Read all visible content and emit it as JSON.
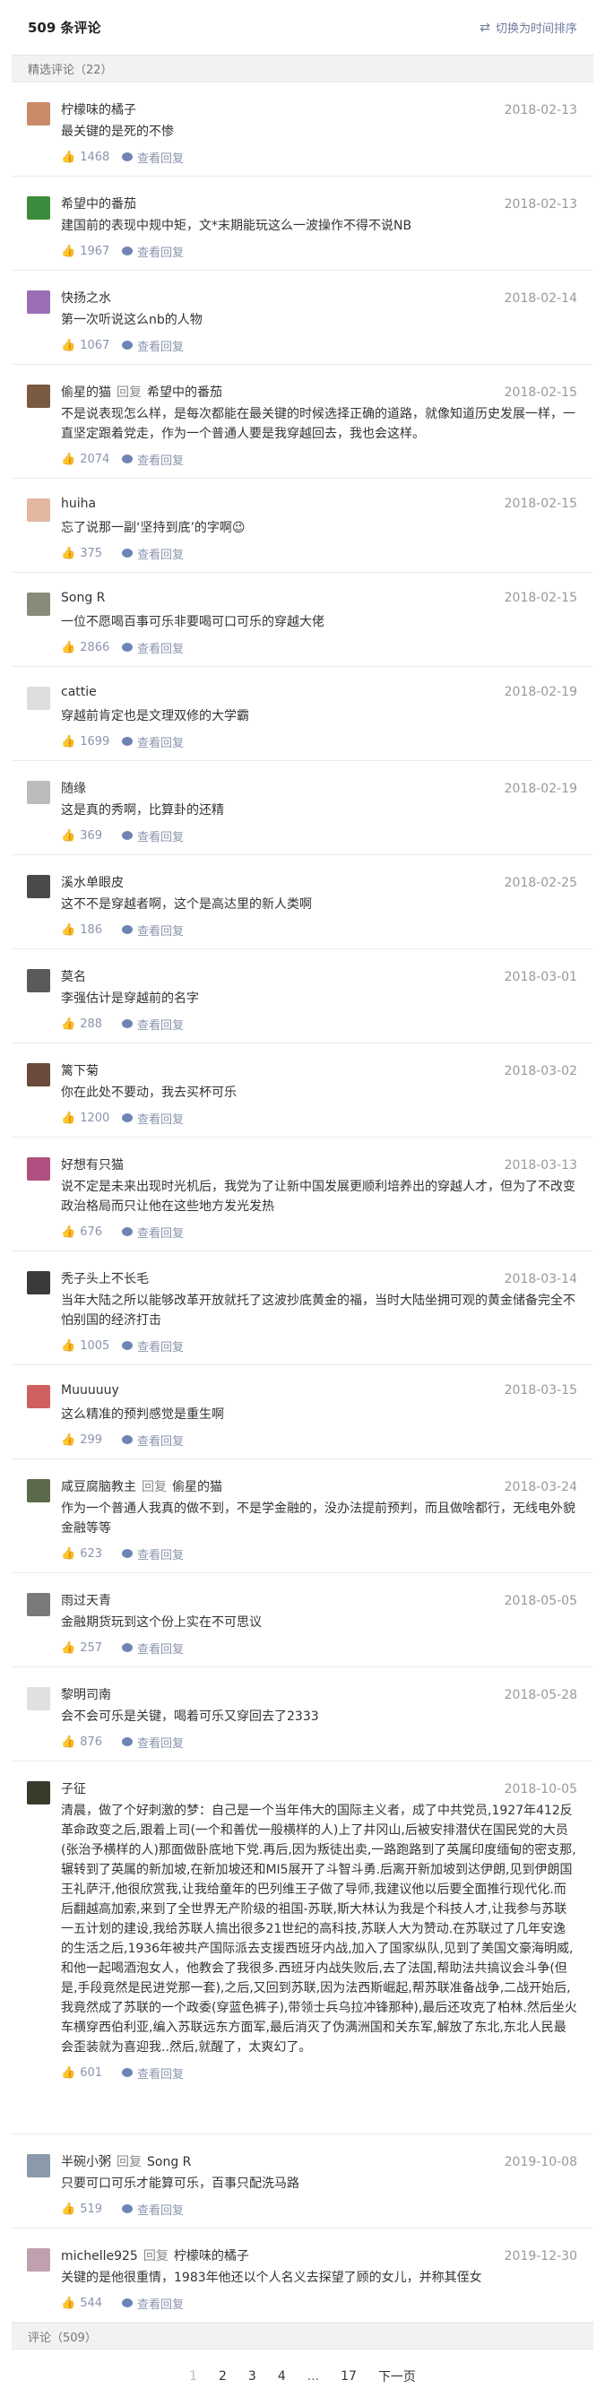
{
  "header": {
    "title": "509 条评论",
    "sort_label": "切换为时间排序"
  },
  "featured": {
    "label": "精选评论（22）"
  },
  "ui": {
    "reply_keyword": "回复",
    "view_reply_label": "查看回复"
  },
  "comments": [
    {
      "user": "柠檬味的橘子",
      "reply_to": "",
      "date": "2018-02-13",
      "text": "最关键的是死的不惨",
      "likes": "1468",
      "avatar_color": "#c98a6a"
    },
    {
      "user": "希望中的番茄",
      "reply_to": "",
      "date": "2018-02-13",
      "text": "建国前的表现中规中矩，文*末期能玩这么一波操作不得不说NB",
      "likes": "1967",
      "avatar_color": "#3d8b3d"
    },
    {
      "user": "快扬之水",
      "reply_to": "",
      "date": "2018-02-14",
      "text": "第一次听说这么nb的人物",
      "likes": "1067",
      "avatar_color": "#9b6fb5"
    },
    {
      "user": "偷星的猫",
      "reply_to": "希望中的番茄",
      "date": "2018-02-15",
      "text": "不是说表现怎么样，是每次都能在最关键的时候选择正确的道路，就像知道历史发展一样，一直坚定跟着党走，作为一个普通人要是我穿越回去，我也会这样。",
      "likes": "2074",
      "avatar_color": "#7a5a40"
    },
    {
      "user": "huiha",
      "reply_to": "",
      "date": "2018-02-15",
      "text": "忘了说那一副‘坚持到底’的字啊😉",
      "likes": "375",
      "avatar_color": "#e3b7a0"
    },
    {
      "user": "Song R",
      "reply_to": "",
      "date": "2018-02-15",
      "text": "一位不愿喝百事可乐非要喝可口可乐的穿越大佬",
      "likes": "2866",
      "avatar_color": "#8a8a7a"
    },
    {
      "user": "cattie",
      "reply_to": "",
      "date": "2018-02-19",
      "text": "穿越前肯定也是文理双修的大学霸",
      "likes": "1699",
      "avatar_color": "#dddddd"
    },
    {
      "user": "随缘",
      "reply_to": "",
      "date": "2018-02-19",
      "text": "这是真的秀啊，比算卦的还精",
      "likes": "369",
      "avatar_color": "#bbbbbb"
    },
    {
      "user": "溪水单眼皮",
      "reply_to": "",
      "date": "2018-02-25",
      "text": "这不不是穿越者啊，这个是高达里的新人类啊",
      "likes": "186",
      "avatar_color": "#4a4a4a"
    },
    {
      "user": "莫名",
      "reply_to": "",
      "date": "2018-03-01",
      "text": "李强估计是穿越前的名字",
      "likes": "288",
      "avatar_color": "#5a5a5a"
    },
    {
      "user": "篱下菊",
      "reply_to": "",
      "date": "2018-03-02",
      "text": "你在此处不要动，我去买杯可乐",
      "likes": "1200",
      "avatar_color": "#6a4a3a"
    },
    {
      "user": "好想有只猫",
      "reply_to": "",
      "date": "2018-03-13",
      "text": "说不定是未来出现时光机后，我党为了让新中国发展更顺利培养出的穿越人才，但为了不改变政治格局而只让他在这些地方发光发热",
      "likes": "676",
      "avatar_color": "#b05080"
    },
    {
      "user": "秃子头上不长毛",
      "reply_to": "",
      "date": "2018-03-14",
      "text": "当年大陆之所以能够改革开放就托了这波抄底黄金的福，当时大陆坐拥可观的黄金储备完全不怕别国的经济打击",
      "likes": "1005",
      "avatar_color": "#3a3a3a"
    },
    {
      "user": "Muuuuuy",
      "reply_to": "",
      "date": "2018-03-15",
      "text": "这么精准的预判感觉是重生啊",
      "likes": "299",
      "avatar_color": "#d06060"
    },
    {
      "user": "咸豆腐脑教主",
      "reply_to": "偷星的猫",
      "date": "2018-03-24",
      "text": "作为一个普通人我真的做不到，不是学金融的，没办法提前预判，而且做啥都行，无线电外貌金融等等",
      "likes": "623",
      "avatar_color": "#5a6a4a"
    },
    {
      "user": "雨过天青",
      "reply_to": "",
      "date": "2018-05-05",
      "text": "金融期货玩到这个份上实在不可思议",
      "likes": "257",
      "avatar_color": "#7a7a7a"
    },
    {
      "user": "黎明司南",
      "reply_to": "",
      "date": "2018-05-28",
      "text": "会不会可乐是关键，喝着可乐又穿回去了2333",
      "likes": "876",
      "avatar_color": "#e0e0e0"
    },
    {
      "user": "子征",
      "reply_to": "",
      "date": "2018-10-05",
      "text": "清晨，做了个好刺激的梦：自己是一个当年伟大的国际主义者，成了中共党员,1927年412反革命政变之后,跟着上司(一个和善优一般横样的人)上了井冈山,后被安排潜伏在国民党的大员(张治予横样的人)那面做卧底地下党.再后,因为叛徒出卖,一路跑路到了英属印度缅甸的密支那,辗转到了英属的新加坡,在新加坡还和MI5展开了斗智斗勇.后离开新加坡到达伊朗,见到伊朗国王礼萨汗,他很欣赏我,让我给童年的巴列维王子做了导师,我建议他以后要全面推行现代化.而后翻越高加索,来到了全世界无产阶级的祖国-苏联,斯大林认为我是个科技人才,让我参与苏联一五计划的建设,我给苏联人搞出很多21世纪的高科技,苏联人大为赞动.在苏联过了几年安逸的生活之后,1936年被共产国际派去支援西班牙内战,加入了国家纵队,见到了美国文豪海明威,和他一起喝酒泡女人，他教会了我很多.西班牙内战失败后,去了法国,帮助法共搞议会斗争(但是,手段竟然是民进党那一套),之后,又回到苏联,因为法西斯崛起,帮苏联准备战争,二战开始后,我竟然成了苏联的一个政委(穿蓝色裤子),带领士兵乌拉冲锋那种),最后还攻克了柏林.然后坐火车横穿西伯利亚,编入苏联远东方面军,最后消灭了伪满洲国和关东军,解放了东北,东北人民最会歪装就为喜迎我..然后,就醒了，太爽幻了。",
      "likes": "601",
      "avatar_color": "#3a3a2a"
    },
    {
      "user": "半碗小粥",
      "reply_to": "Song R",
      "date": "2019-10-08",
      "text": "只要可口可乐才能算可乐，百事只配洗马路",
      "likes": "519",
      "avatar_color": "#8a9aaa"
    },
    {
      "user": "michelle925",
      "reply_to": "柠檬味的橘子",
      "date": "2019-12-30",
      "text": "关键的是他很重情，1983年他还以个人名义去探望了顾的女儿，并称其侄女",
      "likes": "544",
      "avatar_color": "#c0a0b0"
    }
  ],
  "footer": {
    "label": "评论（509）"
  },
  "pagination": {
    "pages": [
      "1",
      "2",
      "3",
      "4"
    ],
    "ellipsis": "...",
    "last": "17",
    "next": "下一页"
  }
}
